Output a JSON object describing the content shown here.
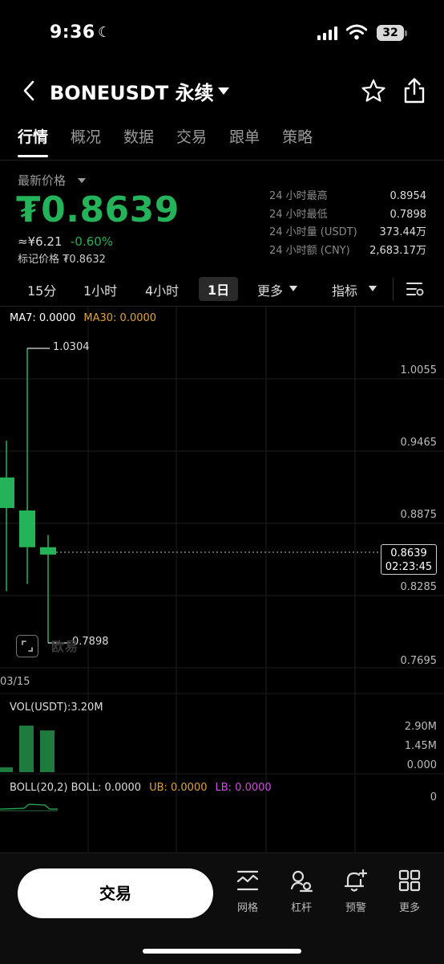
{
  "status": {
    "time": "9:36",
    "battery": "32"
  },
  "header": {
    "title": "BONEUSDT 永续"
  },
  "tabs": [
    "行情",
    "概况",
    "数据",
    "交易",
    "跟单",
    "策略"
  ],
  "price": {
    "label": "最新价格",
    "value": "₮0.8639",
    "cny": "≈¥6.21",
    "change": "-0.60%",
    "mark": "标记价格 ₮0.8632"
  },
  "stats": [
    {
      "label": "24 小时最高",
      "value": "0.8954"
    },
    {
      "label": "24 小时最低",
      "value": "0.7898"
    },
    {
      "label": "24 小时量 (USDT)",
      "value": "373.44万"
    },
    {
      "label": "24 小时额 (CNY)",
      "value": "2,683.17万"
    }
  ],
  "intervals": {
    "i15": "15分",
    "i1h": "1小时",
    "i4h": "4小时",
    "i1d": "1日",
    "more": "更多",
    "indicators": "指标"
  },
  "chart": {
    "ma7": "MA7: 0.0000",
    "ma30": "MA30: 0.0000",
    "y_labels": [
      "1.0055",
      "0.9465",
      "0.8875",
      "0.8285",
      "0.7695"
    ],
    "high_label": "1.0304",
    "low_label": "0.7898",
    "current_price": "0.8639",
    "countdown": "02:23:45",
    "date": "03/15",
    "watermark": "欧易",
    "vol_label": "VOL(USDT):3.20M",
    "vol_y_labels": [
      "2.90M",
      "1.45M",
      "0.000"
    ],
    "boll_prefix": "BOLL(20,2)",
    "boll": "BOLL: 0.0000",
    "ub": "UB: 0.0000",
    "lb": "LB: 0.0000",
    "boll_y": "0",
    "colors": {
      "up": "#25b35a",
      "vol": "#1f7a3e",
      "ma30": "#e0a33a",
      "lb": "#d24de0"
    }
  },
  "chart_data": {
    "type": "candlestick",
    "ylim": [
      0.7695,
      1.0304
    ],
    "candles": [
      {
        "open": 0.9,
        "close": 0.925,
        "high": 0.955,
        "low": 0.832
      },
      {
        "open": 0.868,
        "close": 0.898,
        "high": 1.0304,
        "low": 0.838
      },
      {
        "open": 0.862,
        "close": 0.868,
        "high": 0.878,
        "low": 0.7898
      }
    ],
    "volumes": [
      0.3,
      2.9,
      2.6
    ],
    "vol_ylim": [
      0,
      2.9
    ]
  },
  "bottom": {
    "trade": "交易",
    "grid": "网格",
    "leverage": "杠杆",
    "alert": "预警",
    "more": "更多"
  }
}
